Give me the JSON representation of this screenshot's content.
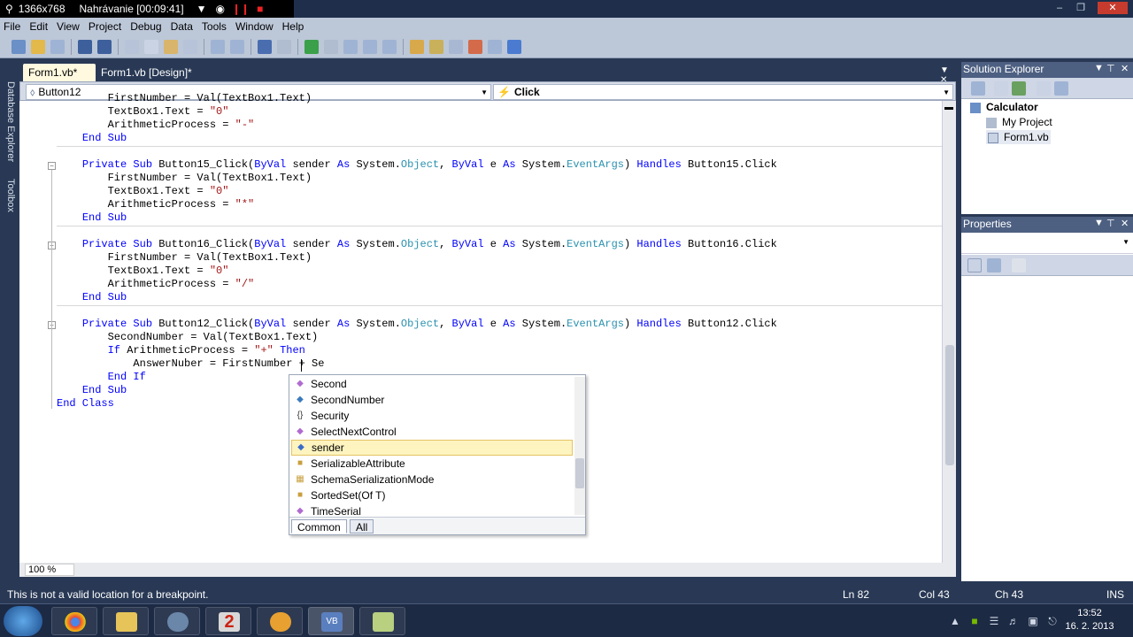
{
  "recorder": {
    "resolution": "1366x768",
    "status": "Nahrávanie [00:09:41]"
  },
  "menu": [
    "File",
    "Edit",
    "View",
    "Project",
    "Debug",
    "Data",
    "Tools",
    "Window",
    "Help"
  ],
  "left_tabs": [
    "Database Explorer",
    "Toolbox"
  ],
  "doc_tabs": [
    {
      "label": "Form1.vb*",
      "active": true
    },
    {
      "label": "Form1.vb [Design]*",
      "active": false
    }
  ],
  "nav": {
    "object": "Button12",
    "event": "Click"
  },
  "code": {
    "lines": [
      [
        {
          "t": "        FirstNumber = Val(TextBox1.Text)"
        }
      ],
      [
        {
          "t": "        TextBox1.Text = "
        },
        {
          "t": "\"0\"",
          "c": "st"
        }
      ],
      [
        {
          "t": "        ArithmeticProcess = "
        },
        {
          "t": "\"-\"",
          "c": "st"
        }
      ],
      [
        {
          "t": "    "
        },
        {
          "t": "End Sub",
          "c": "kw"
        }
      ],
      [
        {
          "t": ""
        }
      ],
      [
        {
          "t": "    "
        },
        {
          "t": "Private Sub",
          "c": "kw"
        },
        {
          "t": " Button15_Click("
        },
        {
          "t": "ByVal",
          "c": "kw"
        },
        {
          "t": " sender "
        },
        {
          "t": "As",
          "c": "kw"
        },
        {
          "t": " System."
        },
        {
          "t": "Object",
          "c": "ty"
        },
        {
          "t": ", "
        },
        {
          "t": "ByVal",
          "c": "kw"
        },
        {
          "t": " e "
        },
        {
          "t": "As",
          "c": "kw"
        },
        {
          "t": " System."
        },
        {
          "t": "EventArgs",
          "c": "ty"
        },
        {
          "t": ") "
        },
        {
          "t": "Handles",
          "c": "kw"
        },
        {
          "t": " Button15.Click"
        }
      ],
      [
        {
          "t": "        FirstNumber = Val(TextBox1.Text)"
        }
      ],
      [
        {
          "t": "        TextBox1.Text = "
        },
        {
          "t": "\"0\"",
          "c": "st"
        }
      ],
      [
        {
          "t": "        ArithmeticProcess = "
        },
        {
          "t": "\"*\"",
          "c": "st"
        }
      ],
      [
        {
          "t": "    "
        },
        {
          "t": "End Sub",
          "c": "kw"
        }
      ],
      [
        {
          "t": ""
        }
      ],
      [
        {
          "t": "    "
        },
        {
          "t": "Private Sub",
          "c": "kw"
        },
        {
          "t": " Button16_Click("
        },
        {
          "t": "ByVal",
          "c": "kw"
        },
        {
          "t": " sender "
        },
        {
          "t": "As",
          "c": "kw"
        },
        {
          "t": " System."
        },
        {
          "t": "Object",
          "c": "ty"
        },
        {
          "t": ", "
        },
        {
          "t": "ByVal",
          "c": "kw"
        },
        {
          "t": " e "
        },
        {
          "t": "As",
          "c": "kw"
        },
        {
          "t": " System."
        },
        {
          "t": "EventArgs",
          "c": "ty"
        },
        {
          "t": ") "
        },
        {
          "t": "Handles",
          "c": "kw"
        },
        {
          "t": " Button16.Click"
        }
      ],
      [
        {
          "t": "        FirstNumber = Val(TextBox1.Text)"
        }
      ],
      [
        {
          "t": "        TextBox1.Text = "
        },
        {
          "t": "\"0\"",
          "c": "st"
        }
      ],
      [
        {
          "t": "        ArithmeticProcess = "
        },
        {
          "t": "\"/\"",
          "c": "st"
        }
      ],
      [
        {
          "t": "    "
        },
        {
          "t": "End Sub",
          "c": "kw"
        }
      ],
      [
        {
          "t": ""
        }
      ],
      [
        {
          "t": "    "
        },
        {
          "t": "Private Sub",
          "c": "kw"
        },
        {
          "t": " Button12_Click("
        },
        {
          "t": "ByVal",
          "c": "kw"
        },
        {
          "t": " sender "
        },
        {
          "t": "As",
          "c": "kw"
        },
        {
          "t": " System."
        },
        {
          "t": "Object",
          "c": "ty"
        },
        {
          "t": ", "
        },
        {
          "t": "ByVal",
          "c": "kw"
        },
        {
          "t": " e "
        },
        {
          "t": "As",
          "c": "kw"
        },
        {
          "t": " System."
        },
        {
          "t": "EventArgs",
          "c": "ty"
        },
        {
          "t": ") "
        },
        {
          "t": "Handles",
          "c": "kw"
        },
        {
          "t": " Button12.Click"
        }
      ],
      [
        {
          "t": "        SecondNumber = Val(TextBox1.Text)"
        }
      ],
      [
        {
          "t": "        "
        },
        {
          "t": "If",
          "c": "kw"
        },
        {
          "t": " ArithmeticProcess = "
        },
        {
          "t": "\"+\"",
          "c": "st"
        },
        {
          "t": " "
        },
        {
          "t": "Then",
          "c": "kw"
        }
      ],
      [
        {
          "t": "            AnswerNuber = FirstNumber + Se"
        }
      ],
      [
        {
          "t": "        "
        },
        {
          "t": "End If",
          "c": "kw"
        }
      ],
      [
        {
          "t": "    "
        },
        {
          "t": "End Sub",
          "c": "kw"
        }
      ],
      [
        {
          "t": "End Class",
          "c": "kw"
        }
      ]
    ]
  },
  "intellisense": {
    "items": [
      {
        "label": "Second",
        "icon": "property-icon",
        "selected": false
      },
      {
        "label": "SecondNumber",
        "icon": "field-icon",
        "selected": false
      },
      {
        "label": "Security",
        "icon": "namespace-icon",
        "selected": false
      },
      {
        "label": "SelectNextControl",
        "icon": "method-icon",
        "selected": false
      },
      {
        "label": "sender",
        "icon": "parameter-icon",
        "selected": true
      },
      {
        "label": "SerializableAttribute",
        "icon": "class-icon",
        "selected": false
      },
      {
        "label": "SchemaSerializationMode",
        "icon": "enum-icon",
        "selected": false
      },
      {
        "label": "SortedSet(Of T)",
        "icon": "class-icon",
        "selected": false
      },
      {
        "label": "TimeSerial",
        "icon": "method-icon",
        "selected": false
      }
    ],
    "tabs": {
      "common": "Common",
      "all": "All"
    }
  },
  "solution_explorer": {
    "title": "Solution Explorer",
    "solution": "Calculator",
    "items": [
      "My Project",
      "Form1.vb"
    ]
  },
  "properties": {
    "title": "Properties"
  },
  "editor": {
    "zoom": "100 %"
  },
  "status": {
    "message": "This is not a valid location for a breakpoint.",
    "ln": "Ln 82",
    "col": "Col 43",
    "ch": "Ch 43",
    "mode": "INS"
  },
  "clock": {
    "time": "13:52",
    "date": "16. 2. 2013"
  },
  "colors": {
    "keyword": "#0000ff",
    "type": "#2b91af",
    "string": "#a31515",
    "chrome": "#293955"
  }
}
